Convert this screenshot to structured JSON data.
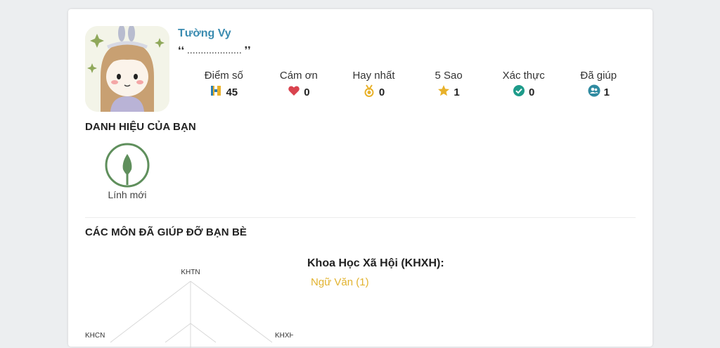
{
  "profile": {
    "name": "Tường Vy",
    "quote": "❛❛ .................... ❜❜"
  },
  "stats": [
    {
      "label": "Điểm số",
      "value": "45",
      "icon": "score-icon",
      "color": "#e8b12a"
    },
    {
      "label": "Cám ơn",
      "value": "0",
      "icon": "heart-icon",
      "color": "#d9434e"
    },
    {
      "label": "Hay nhất",
      "value": "0",
      "icon": "medal-icon",
      "color": "#e8b12a"
    },
    {
      "label": "5 Sao",
      "value": "1",
      "icon": "star-icon",
      "color": "#e8b12a"
    },
    {
      "label": "Xác thực",
      "value": "0",
      "icon": "verified-icon",
      "color": "#1e9b8a"
    },
    {
      "label": "Đã giúp",
      "value": "1",
      "icon": "users-icon",
      "color": "#2f8aa0"
    }
  ],
  "titles_section": {
    "heading": "DANH HIỆU CỦA BẠN",
    "badges": [
      {
        "label": "Lính mới",
        "icon": "leaf-icon",
        "color": "#5f8f5c"
      }
    ]
  },
  "subjects_section": {
    "heading": "CÁC MÔN ĐÃ GIÚP ĐỠ BẠN BÈ",
    "radar_labels": [
      "KHTN",
      "KHXH",
      "KHCN"
    ],
    "group_title": "Khoa Học Xã Hội (KHXH):",
    "subjects": [
      "Ngữ Văn (1)"
    ]
  }
}
